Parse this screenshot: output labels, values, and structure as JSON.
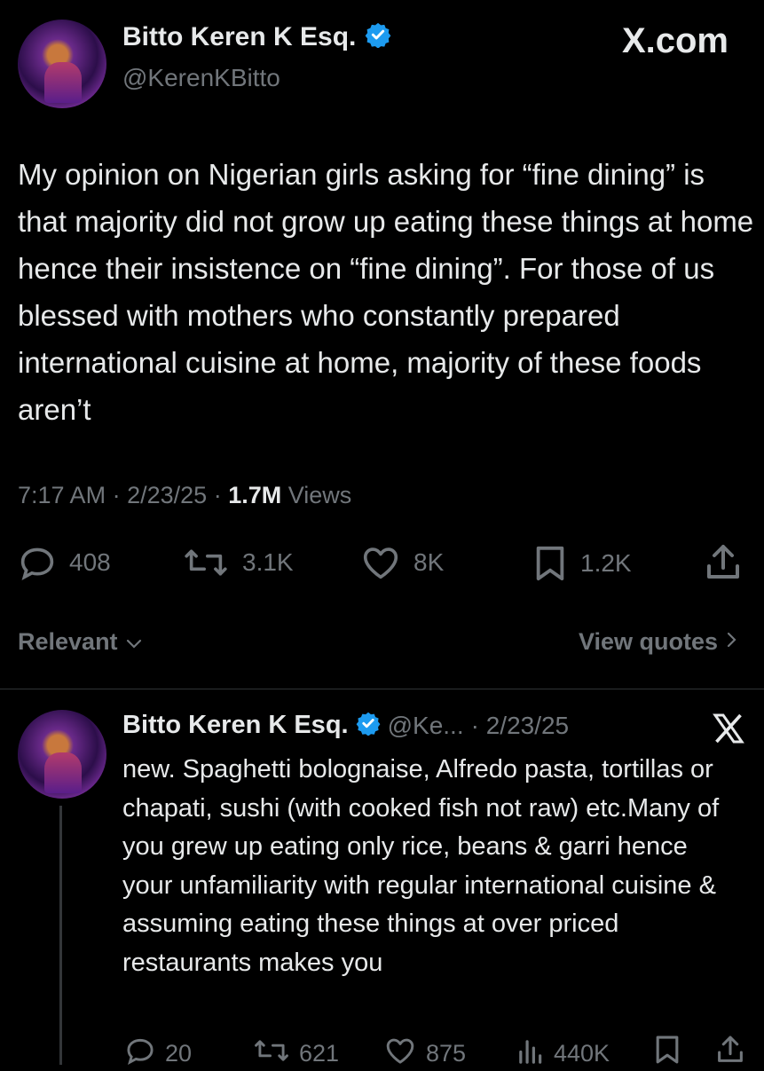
{
  "site": {
    "brand": "X.com"
  },
  "tweet": {
    "author_name": "Bitto Keren K Esq.",
    "author_handle": "@KerenKBitto",
    "text": "My opinion on Nigerian girls asking for “fine dining” is that majority did not grow up eating these things at home hence their insistence on “fine dining”. For those of us blessed with mothers who constantly prepared international cuisine at home, majority of these foods aren’t",
    "time": "7:17 AM",
    "date": "2/23/25",
    "views_count": "1.7M",
    "views_label": "Views",
    "replies": "408",
    "reposts": "3.1K",
    "likes": "8K",
    "bookmarks": "1.2K"
  },
  "sort": {
    "label": "Relevant",
    "view_quotes": "View quotes"
  },
  "reply": {
    "author_name": "Bitto Keren K Esq.",
    "author_handle": "@Ke...",
    "date": "· 2/23/25",
    "text": "new. Spaghetti bolognaise, Alfredo pasta, tortillas or chapati, sushi (with cooked fish not raw) etc.Many of you grew up eating only rice, beans & garri hence your unfamiliarity with regular international cuisine & assuming eating these things at over priced restaurants makes you",
    "replies": "20",
    "reposts": "621",
    "likes": "875",
    "views": "440K"
  },
  "colors": {
    "background": "#000000",
    "verified": "#1d9bf0",
    "muted": "#71767b",
    "text": "#e7e9ea"
  },
  "icons": [
    "verified-badge-icon",
    "x-logo-icon",
    "reply-icon",
    "repost-icon",
    "like-icon",
    "bookmark-icon",
    "share-icon",
    "views-icon",
    "chevron-down-icon",
    "chevron-right-icon"
  ]
}
